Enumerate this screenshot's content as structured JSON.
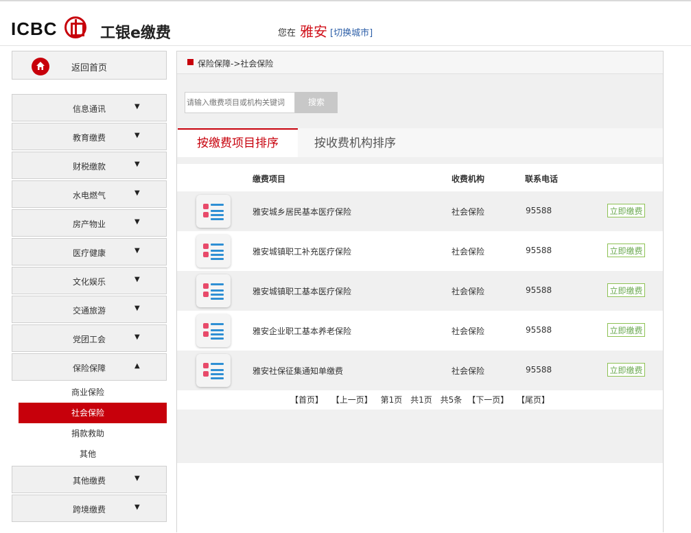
{
  "header": {
    "logo_text": "ICBC",
    "brand": "工银e缴费",
    "city_prefix": "您在",
    "city": "雅安",
    "city_switch": "[切换城市]"
  },
  "sidebar": {
    "home_label": "返回首页",
    "menu": [
      {
        "label": "信息通讯",
        "arrow": "▼"
      },
      {
        "label": "教育缴费",
        "arrow": "▼"
      },
      {
        "label": "财税缴款",
        "arrow": "▼"
      },
      {
        "label": "水电燃气",
        "arrow": "▼"
      },
      {
        "label": "房产物业",
        "arrow": "▼"
      },
      {
        "label": "医疗健康",
        "arrow": "▼"
      },
      {
        "label": "文化娱乐",
        "arrow": "▼"
      },
      {
        "label": "交通旅游",
        "arrow": "▼"
      },
      {
        "label": "党团工会",
        "arrow": "▼"
      },
      {
        "label": "保险保障",
        "arrow": "▲"
      }
    ],
    "submenu": [
      "商业保险",
      "社会保险",
      "捐款救助",
      "其他"
    ],
    "menu_after": [
      {
        "label": "其他缴费",
        "arrow": "▼"
      },
      {
        "label": "跨境缴费",
        "arrow": "▼"
      }
    ]
  },
  "main": {
    "breadcrumb": "保险保障->社会保险",
    "search_placeholder": "请输入缴费项目或机构关键词",
    "search_button": "搜索",
    "tabs": [
      "按缴费项目排序",
      "按收费机构排序"
    ],
    "columns": [
      "缴费项目",
      "收费机构",
      "联系电话"
    ],
    "rows": [
      {
        "item": "雅安城乡居民基本医疗保险",
        "org": "社会保险",
        "phone": "95588",
        "action": "立即缴费"
      },
      {
        "item": "雅安城镇职工补充医疗保险",
        "org": "社会保险",
        "phone": "95588",
        "action": "立即缴费"
      },
      {
        "item": "雅安城镇职工基本医疗保险",
        "org": "社会保险",
        "phone": "95588",
        "action": "立即缴费"
      },
      {
        "item": "雅安企业职工基本养老保险",
        "org": "社会保险",
        "phone": "95588",
        "action": "立即缴费"
      },
      {
        "item": "雅安社保征集通知单缴费",
        "org": "社会保险",
        "phone": "95588",
        "action": "立即缴费"
      }
    ],
    "pager": {
      "first": "【首页】",
      "prev": "【上一页】",
      "page": "第1页",
      "total_pages": "共1页",
      "total_items": "共5条",
      "next": "【下一页】",
      "last": "【尾页】"
    }
  },
  "colors": {
    "brand_red": "#c7000b",
    "pay_green": "#8cc152"
  }
}
